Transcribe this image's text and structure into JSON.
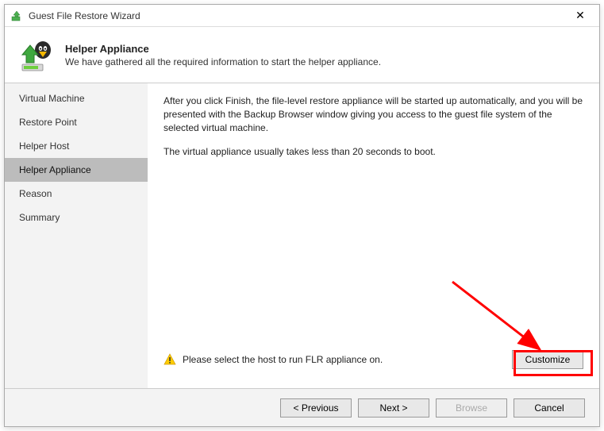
{
  "window": {
    "title": "Guest File Restore Wizard"
  },
  "header": {
    "title": "Helper Appliance",
    "subtitle": "We have gathered all the required information to start the helper appliance."
  },
  "sidebar": {
    "items": [
      {
        "label": "Virtual Machine"
      },
      {
        "label": "Restore Point"
      },
      {
        "label": "Helper Host"
      },
      {
        "label": "Helper Appliance"
      },
      {
        "label": "Reason"
      },
      {
        "label": "Summary"
      }
    ]
  },
  "main": {
    "paragraph1": "After you click Finish, the file-level restore appliance will be started up automatically, and you will be presented with the Backup Browser window giving you access to the guest file system of the selected virtual machine.",
    "paragraph2": "The virtual appliance usually takes less than 20 seconds to boot.",
    "warning_text": "Please select the host to run FLR appliance on.",
    "customize_label": "Customize"
  },
  "footer": {
    "previous_label": "< Previous",
    "next_label": "Next >",
    "browse_label": "Browse",
    "cancel_label": "Cancel"
  }
}
